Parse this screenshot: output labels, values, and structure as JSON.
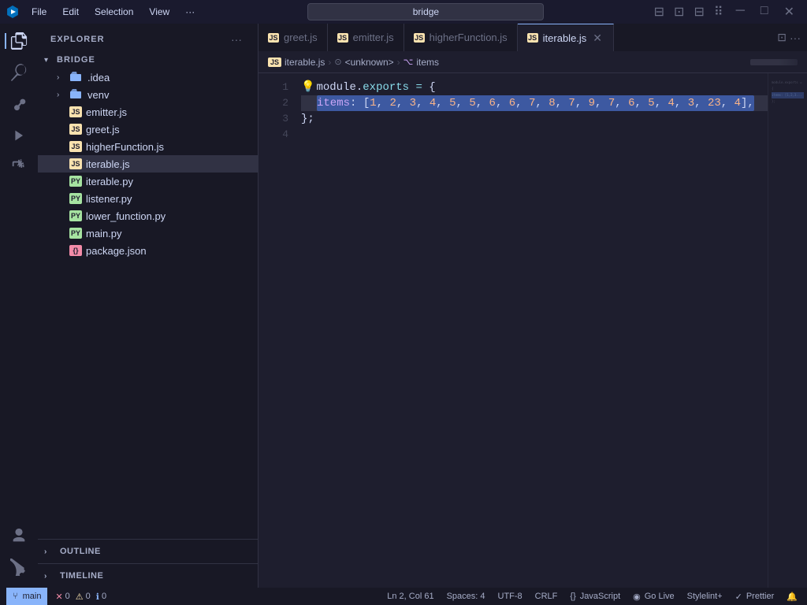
{
  "titlebar": {
    "app_icon": "◈",
    "menu_items": [
      "File",
      "Edit",
      "Selection",
      "View",
      "···"
    ],
    "search_placeholder": "bridge",
    "search_value": "bridge",
    "controls": [
      "⊟",
      "❐",
      "✕"
    ]
  },
  "activity_bar": {
    "icons": [
      {
        "name": "explorer-icon",
        "symbol": "⧉",
        "active": true
      },
      {
        "name": "search-icon",
        "symbol": "🔍",
        "active": false
      },
      {
        "name": "source-control-icon",
        "symbol": "⑂",
        "active": false
      },
      {
        "name": "run-icon",
        "symbol": "▷",
        "active": false
      },
      {
        "name": "extensions-icon",
        "symbol": "⊞",
        "active": false
      }
    ],
    "bottom_icons": [
      {
        "name": "account-icon",
        "symbol": "◯"
      },
      {
        "name": "settings-icon",
        "symbol": "⚙"
      }
    ]
  },
  "sidebar": {
    "title": "EXPLORER",
    "more_button": "···",
    "project": {
      "name": "BRIDGE",
      "expanded": true
    },
    "tree": [
      {
        "type": "folder",
        "name": ".idea",
        "indent": 1,
        "expanded": false
      },
      {
        "type": "folder",
        "name": "venv",
        "indent": 1,
        "expanded": false
      },
      {
        "type": "file",
        "name": "emitter.js",
        "indent": 1,
        "icon": "JS"
      },
      {
        "type": "file",
        "name": "greet.js",
        "indent": 1,
        "icon": "JS"
      },
      {
        "type": "file",
        "name": "higherFunction.js",
        "indent": 1,
        "icon": "JS"
      },
      {
        "type": "file",
        "name": "iterable.js",
        "indent": 1,
        "icon": "JS",
        "active": true
      },
      {
        "type": "file",
        "name": "iterable.py",
        "indent": 1,
        "icon": "PY"
      },
      {
        "type": "file",
        "name": "listener.py",
        "indent": 1,
        "icon": "PY"
      },
      {
        "type": "file",
        "name": "lower_function.py",
        "indent": 1,
        "icon": "PY"
      },
      {
        "type": "file",
        "name": "main.py",
        "indent": 1,
        "icon": "PY"
      },
      {
        "type": "file",
        "name": "package.json",
        "indent": 1,
        "icon": "{}"
      }
    ],
    "panels": [
      {
        "name": "OUTLINE"
      },
      {
        "name": "TIMELINE"
      }
    ]
  },
  "tabs": [
    {
      "label": "greet.js",
      "icon": "JS",
      "active": false,
      "closable": false
    },
    {
      "label": "emitter.js",
      "icon": "JS",
      "active": false,
      "closable": false
    },
    {
      "label": "higherFunction.js",
      "icon": "JS",
      "active": false,
      "closable": false
    },
    {
      "label": "iterable.js",
      "icon": "JS",
      "active": true,
      "closable": true
    }
  ],
  "breadcrumb": {
    "parts": [
      "iterable.js",
      "<unknown>",
      "items"
    ]
  },
  "code": {
    "lines": [
      {
        "num": "1",
        "content": "module.exports = {",
        "highlighted": false
      },
      {
        "num": "2",
        "content": "    items: [1, 2, 3, 4, 5, 5, 6, 6, 7, 8, 7, 9, 7, 6, 5, 4, 3, 23, 4],",
        "highlighted": true
      },
      {
        "num": "3",
        "content": "};",
        "highlighted": false
      },
      {
        "num": "4",
        "content": "",
        "highlighted": false
      }
    ]
  },
  "status_bar": {
    "git_branch": "main",
    "errors": "0",
    "warnings": "0",
    "info": "0",
    "position": "Ln 2, Col 61",
    "spaces": "Spaces: 4",
    "encoding": "UTF-8",
    "line_ending": "CRLF",
    "language": "JavaScript",
    "go_live": "Go Live",
    "stylelint": "Stylelint+",
    "prettier": "Prettier",
    "notifications": "🔔"
  }
}
